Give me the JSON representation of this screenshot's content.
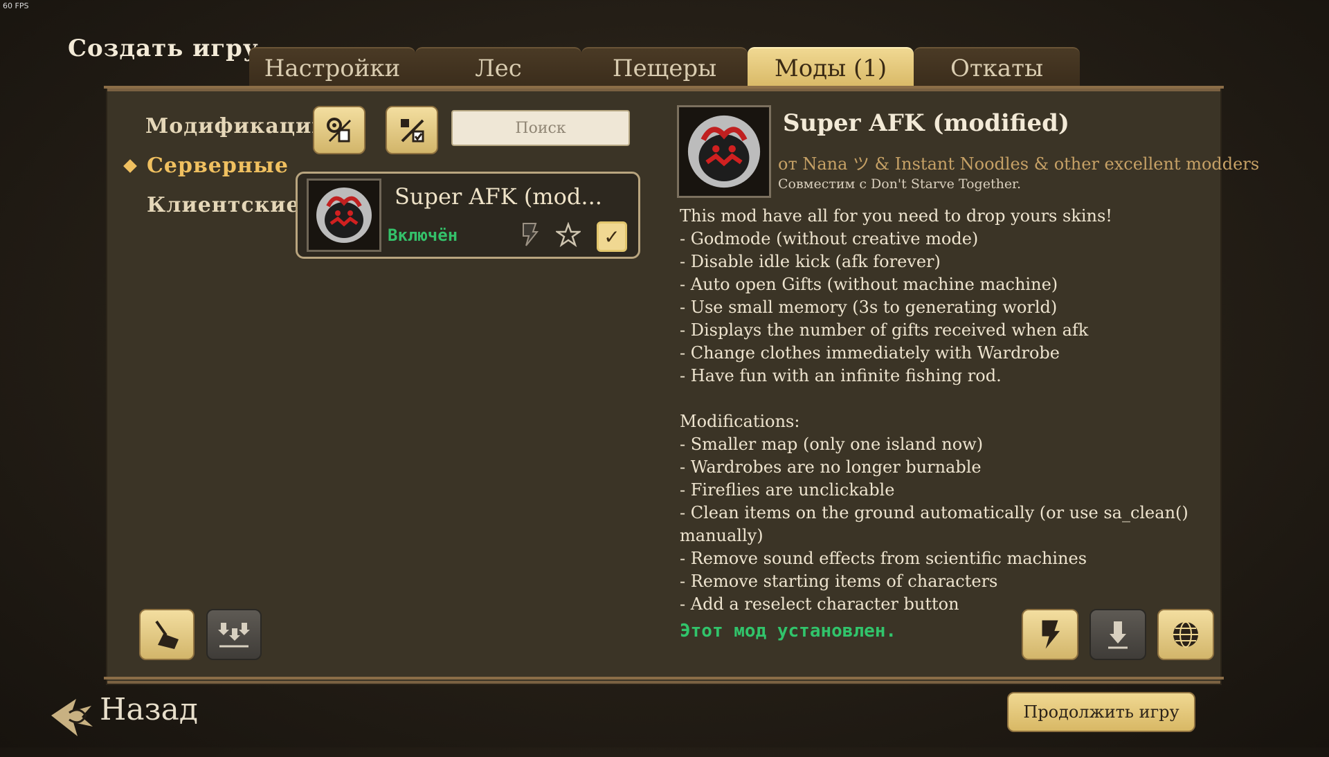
{
  "fps": "60 FPS",
  "page": {
    "title": "Создать игру"
  },
  "tabs": [
    {
      "label": "Настройки"
    },
    {
      "label": "Лес"
    },
    {
      "label": "Пещеры"
    },
    {
      "label": "Моды (1)"
    },
    {
      "label": "Откаты"
    }
  ],
  "active_tab": "Моды (1)",
  "sidebar": {
    "header": "Модификации",
    "items": [
      {
        "label": "Серверные",
        "selected": true
      },
      {
        "label": "Клиентские",
        "selected": false
      }
    ]
  },
  "search": {
    "placeholder": "Поиск"
  },
  "mod_list": [
    {
      "name": "Super AFK  (mod...",
      "status": "Включён",
      "enabled": true
    }
  ],
  "detail": {
    "title": "Super AFK  (modified)",
    "author": "от Nana ツ & Instant Noodles & other excellent modders",
    "compat": "Совместим с Don't Starve Together.",
    "description": "This mod have all for you need to drop yours skins!\n- Godmode (without creative mode)\n- Disable idle kick (afk forever)\n- Auto open Gifts (without machine machine)\n- Use small memory (3s to generating world)\n- Displays the number of gifts received when afk\n- Change clothes immediately with Wardrobe\n- Have fun with an infinite fishing rod.\n\nModifications:\n- Smaller map (only one island now)\n- Wardrobes are no longer burnable\n- Fireflies are unclickable\n- Clean items on the ground automatically (or use sa_clean() manually)\n- Remove sound effects from scientific machines\n- Remove starting items of characters\n- Add a reselect character button",
    "installed_text": "Этот мод установлен."
  },
  "footer": {
    "back_label": "Назад",
    "continue_label": "Продолжить игру"
  },
  "icons": {
    "settings_all": "gear-paper-icon",
    "enable_all": "percent-check-icon",
    "clean": "broom-icon",
    "update_all": "multi-download-icon",
    "config": "bolt-icon",
    "download": "download-icon",
    "web": "globe-icon"
  },
  "colors": {
    "accent": "#f0c060",
    "enabled": "#34c16a",
    "panel": "#3b3426",
    "tab_active": "#f0d892"
  }
}
